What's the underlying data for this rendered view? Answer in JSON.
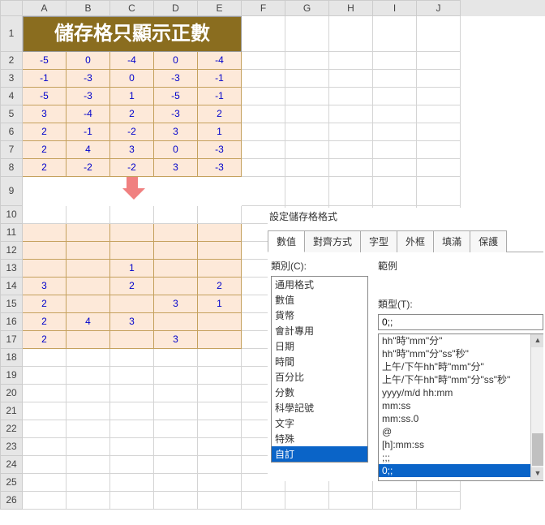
{
  "columns": [
    "A",
    "B",
    "C",
    "D",
    "E",
    "F",
    "G",
    "H",
    "I",
    "J"
  ],
  "rows": [
    "1",
    "2",
    "3",
    "4",
    "5",
    "6",
    "7",
    "8",
    "9",
    "10",
    "11",
    "12",
    "13",
    "14",
    "15",
    "16",
    "17",
    "18",
    "19",
    "20",
    "21",
    "22",
    "23",
    "24",
    "25",
    "26"
  ],
  "title": "儲存格只顯示正數",
  "chart_data": {
    "type": "table",
    "title": "儲存格只顯示正數",
    "source_grid": {
      "columns": [
        "A",
        "B",
        "C",
        "D",
        "E"
      ],
      "rows": [
        [
          -5,
          0,
          -4,
          0,
          -4
        ],
        [
          -1,
          -3,
          0,
          -3,
          -1
        ],
        [
          -5,
          -3,
          1,
          -5,
          -1
        ],
        [
          3,
          -4,
          2,
          -3,
          2
        ],
        [
          2,
          -1,
          -2,
          3,
          1
        ],
        [
          2,
          4,
          3,
          0,
          -3
        ],
        [
          2,
          -2,
          -2,
          3,
          -3
        ]
      ]
    },
    "result_grid_display": {
      "columns": [
        "A",
        "B",
        "C",
        "D",
        "E"
      ],
      "rows": [
        [
          "",
          "",
          "",
          "",
          ""
        ],
        [
          "",
          "",
          "",
          "",
          ""
        ],
        [
          "",
          "",
          "1",
          "",
          ""
        ],
        [
          "3",
          "",
          "2",
          "",
          "2"
        ],
        [
          "2",
          "",
          "",
          "3",
          "1"
        ],
        [
          "2",
          "4",
          "3",
          "",
          ""
        ],
        [
          "2",
          "",
          "",
          "3",
          ""
        ]
      ]
    },
    "format_code": "0;;"
  },
  "dialog": {
    "title": "設定儲存格格式",
    "tabs": [
      "數值",
      "對齊方式",
      "字型",
      "外框",
      "填滿",
      "保護"
    ],
    "category_label": "類別(C):",
    "categories": [
      "通用格式",
      "數值",
      "貨幣",
      "會計專用",
      "日期",
      "時間",
      "百分比",
      "分數",
      "科學記號",
      "文字",
      "特殊",
      "自訂"
    ],
    "selected_category": "自訂",
    "sample_label": "範例",
    "type_label": "類型(T):",
    "type_value": "0;;",
    "formats": [
      "hh\"時\"mm\"分\"",
      "hh\"時\"mm\"分\"ss\"秒\"",
      "上午/下午hh\"時\"mm\"分\"",
      "上午/下午hh\"時\"mm\"分\"ss\"秒\"",
      "yyyy/m/d hh:mm",
      "mm:ss",
      "mm:ss.0",
      "@",
      "[h]:mm:ss",
      ";;;",
      "0;;"
    ],
    "selected_format": "0;;"
  }
}
